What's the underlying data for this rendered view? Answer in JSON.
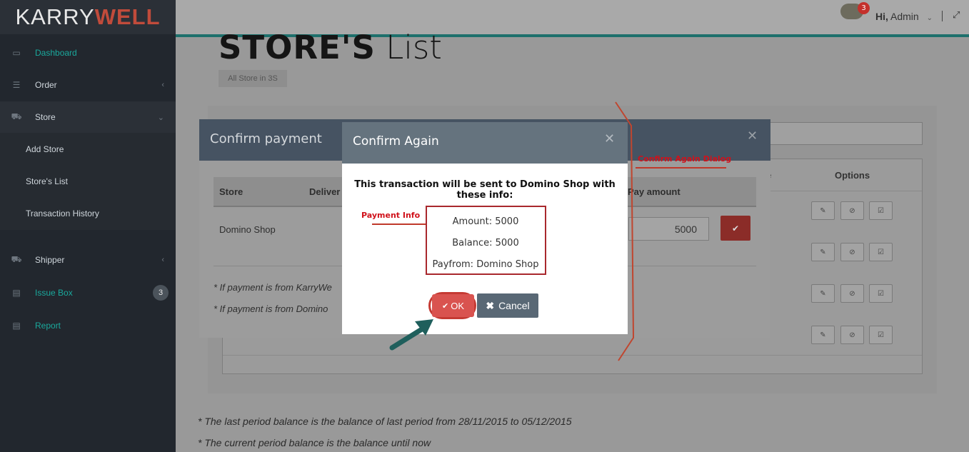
{
  "brand": {
    "part1": "KARRY",
    "part2": "WELL"
  },
  "sidebar": {
    "items": [
      {
        "label": "Dashboard"
      },
      {
        "label": "Order"
      },
      {
        "label": "Store"
      },
      {
        "label": "Shipper"
      },
      {
        "label": "Issue Box",
        "badge": "3"
      },
      {
        "label": "Report"
      }
    ],
    "store_sub": [
      "Add Store",
      "Store's List",
      "Transaction History"
    ]
  },
  "topbar": {
    "notification_count": "3",
    "greeting_hi": "Hi,",
    "user": "Admin"
  },
  "page": {
    "title_bold": "STORE'S",
    "title_light": "List",
    "breadcrumb": "All Store in 3S"
  },
  "table": {
    "col_partial": "e",
    "col_options": "Options"
  },
  "confirm_payment": {
    "title": "Confirm payment",
    "headers": {
      "store": "Store",
      "delivery": "Deliver",
      "pay_amount": "Pay amount"
    },
    "row": {
      "store": "Domino Shop",
      "amount": "5000"
    },
    "notes": [
      "* If payment is from KarryWe",
      "* If payment is from Domino"
    ]
  },
  "confirm_again": {
    "title": "Confirm Again",
    "message": "This transaction will be sent to Domino Shop with these info:",
    "amount": "Amount: 5000",
    "balance": "Balance: 5000",
    "payfrom": "Payfrom: Domino Shop",
    "ok_label": "OK",
    "cancel_label": "Cancel"
  },
  "annotations": {
    "payment_info": "Payment Info",
    "dialog": "Confirm Again Dialog"
  },
  "footnotes": [
    "* The last period balance is the balance of last period from 28/11/2015 to 05/12/2015",
    "* The current period balance is the balance until now"
  ],
  "colors": {
    "accent_teal": "#1d706c",
    "danger": "#d9534f",
    "annotation_red": "#d0121b"
  }
}
